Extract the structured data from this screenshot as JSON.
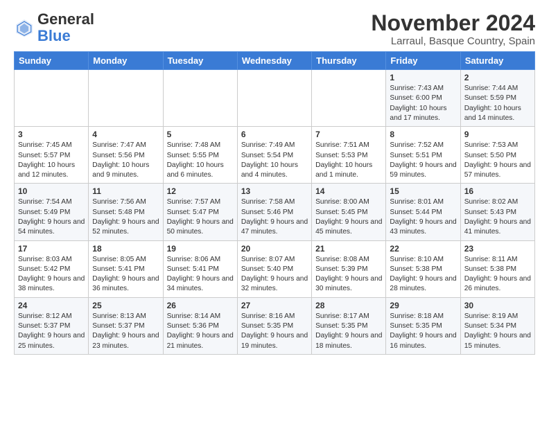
{
  "header": {
    "logo_general": "General",
    "logo_blue": "Blue",
    "month_title": "November 2024",
    "location": "Larraul, Basque Country, Spain"
  },
  "days_of_week": [
    "Sunday",
    "Monday",
    "Tuesday",
    "Wednesday",
    "Thursday",
    "Friday",
    "Saturday"
  ],
  "weeks": [
    [
      {
        "day": "",
        "info": ""
      },
      {
        "day": "",
        "info": ""
      },
      {
        "day": "",
        "info": ""
      },
      {
        "day": "",
        "info": ""
      },
      {
        "day": "",
        "info": ""
      },
      {
        "day": "1",
        "info": "Sunrise: 7:43 AM\nSunset: 6:00 PM\nDaylight: 10 hours and 17 minutes."
      },
      {
        "day": "2",
        "info": "Sunrise: 7:44 AM\nSunset: 5:59 PM\nDaylight: 10 hours and 14 minutes."
      }
    ],
    [
      {
        "day": "3",
        "info": "Sunrise: 7:45 AM\nSunset: 5:57 PM\nDaylight: 10 hours and 12 minutes."
      },
      {
        "day": "4",
        "info": "Sunrise: 7:47 AM\nSunset: 5:56 PM\nDaylight: 10 hours and 9 minutes."
      },
      {
        "day": "5",
        "info": "Sunrise: 7:48 AM\nSunset: 5:55 PM\nDaylight: 10 hours and 6 minutes."
      },
      {
        "day": "6",
        "info": "Sunrise: 7:49 AM\nSunset: 5:54 PM\nDaylight: 10 hours and 4 minutes."
      },
      {
        "day": "7",
        "info": "Sunrise: 7:51 AM\nSunset: 5:53 PM\nDaylight: 10 hours and 1 minute."
      },
      {
        "day": "8",
        "info": "Sunrise: 7:52 AM\nSunset: 5:51 PM\nDaylight: 9 hours and 59 minutes."
      },
      {
        "day": "9",
        "info": "Sunrise: 7:53 AM\nSunset: 5:50 PM\nDaylight: 9 hours and 57 minutes."
      }
    ],
    [
      {
        "day": "10",
        "info": "Sunrise: 7:54 AM\nSunset: 5:49 PM\nDaylight: 9 hours and 54 minutes."
      },
      {
        "day": "11",
        "info": "Sunrise: 7:56 AM\nSunset: 5:48 PM\nDaylight: 9 hours and 52 minutes."
      },
      {
        "day": "12",
        "info": "Sunrise: 7:57 AM\nSunset: 5:47 PM\nDaylight: 9 hours and 50 minutes."
      },
      {
        "day": "13",
        "info": "Sunrise: 7:58 AM\nSunset: 5:46 PM\nDaylight: 9 hours and 47 minutes."
      },
      {
        "day": "14",
        "info": "Sunrise: 8:00 AM\nSunset: 5:45 PM\nDaylight: 9 hours and 45 minutes."
      },
      {
        "day": "15",
        "info": "Sunrise: 8:01 AM\nSunset: 5:44 PM\nDaylight: 9 hours and 43 minutes."
      },
      {
        "day": "16",
        "info": "Sunrise: 8:02 AM\nSunset: 5:43 PM\nDaylight: 9 hours and 41 minutes."
      }
    ],
    [
      {
        "day": "17",
        "info": "Sunrise: 8:03 AM\nSunset: 5:42 PM\nDaylight: 9 hours and 38 minutes."
      },
      {
        "day": "18",
        "info": "Sunrise: 8:05 AM\nSunset: 5:41 PM\nDaylight: 9 hours and 36 minutes."
      },
      {
        "day": "19",
        "info": "Sunrise: 8:06 AM\nSunset: 5:41 PM\nDaylight: 9 hours and 34 minutes."
      },
      {
        "day": "20",
        "info": "Sunrise: 8:07 AM\nSunset: 5:40 PM\nDaylight: 9 hours and 32 minutes."
      },
      {
        "day": "21",
        "info": "Sunrise: 8:08 AM\nSunset: 5:39 PM\nDaylight: 9 hours and 30 minutes."
      },
      {
        "day": "22",
        "info": "Sunrise: 8:10 AM\nSunset: 5:38 PM\nDaylight: 9 hours and 28 minutes."
      },
      {
        "day": "23",
        "info": "Sunrise: 8:11 AM\nSunset: 5:38 PM\nDaylight: 9 hours and 26 minutes."
      }
    ],
    [
      {
        "day": "24",
        "info": "Sunrise: 8:12 AM\nSunset: 5:37 PM\nDaylight: 9 hours and 25 minutes."
      },
      {
        "day": "25",
        "info": "Sunrise: 8:13 AM\nSunset: 5:37 PM\nDaylight: 9 hours and 23 minutes."
      },
      {
        "day": "26",
        "info": "Sunrise: 8:14 AM\nSunset: 5:36 PM\nDaylight: 9 hours and 21 minutes."
      },
      {
        "day": "27",
        "info": "Sunrise: 8:16 AM\nSunset: 5:35 PM\nDaylight: 9 hours and 19 minutes."
      },
      {
        "day": "28",
        "info": "Sunrise: 8:17 AM\nSunset: 5:35 PM\nDaylight: 9 hours and 18 minutes."
      },
      {
        "day": "29",
        "info": "Sunrise: 8:18 AM\nSunset: 5:35 PM\nDaylight: 9 hours and 16 minutes."
      },
      {
        "day": "30",
        "info": "Sunrise: 8:19 AM\nSunset: 5:34 PM\nDaylight: 9 hours and 15 minutes."
      }
    ]
  ]
}
